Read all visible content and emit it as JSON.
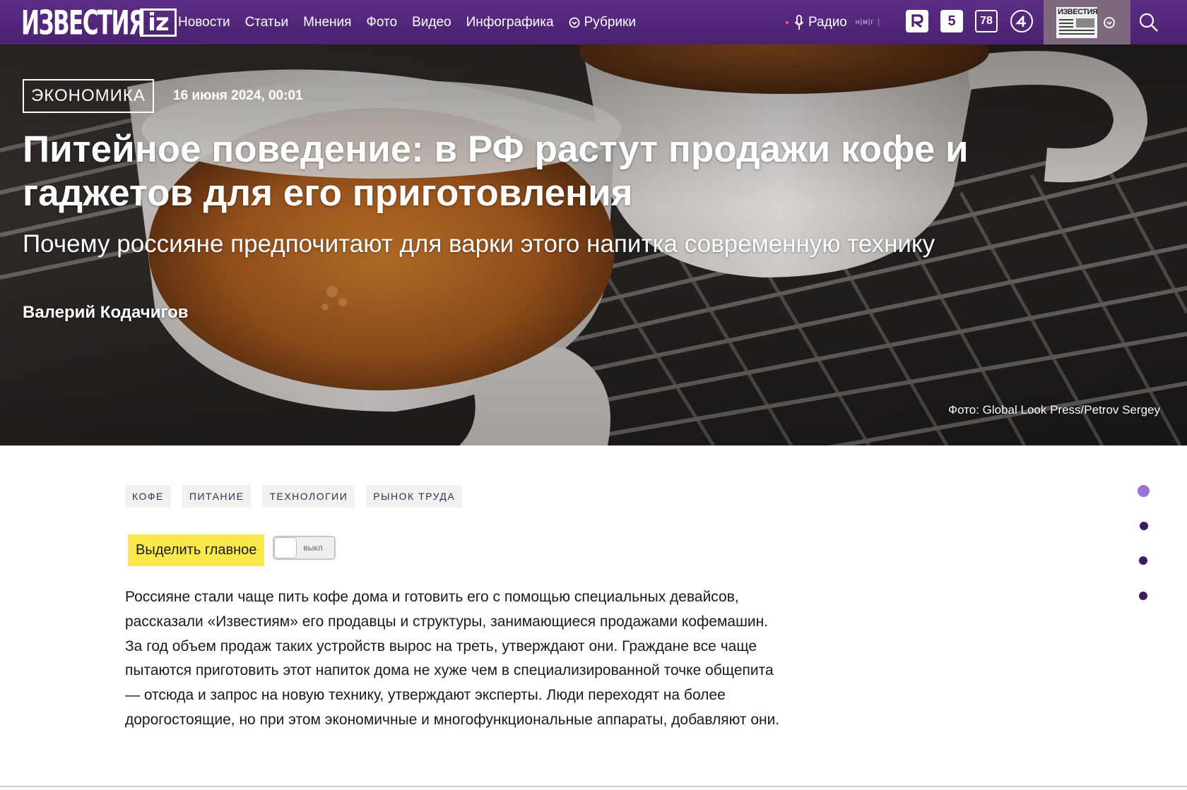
{
  "header": {
    "logo_text": "ИЗВЕСТИЯ",
    "logo_badge": "iz",
    "nav": [
      "Новости",
      "Статьи",
      "Мнения",
      "Фото",
      "Видео",
      "Инфографика"
    ],
    "rubrics_label": "Рубрики",
    "radio_label": "Радио",
    "radio_freq": "н|м|г",
    "channels": [
      {
        "icon": "channel-5-icon",
        "label": "5"
      },
      {
        "icon": "channel-78-icon",
        "label": "78"
      }
    ],
    "paper_icon_text": "ИЗВЕСТИЯ",
    "accent_color": "#4a2270"
  },
  "article": {
    "rubric": "ЭКОНОМИКА",
    "date": "16 июня 2024, 00:01",
    "headline": "Питейное поведение: в РФ растут продажи кофе и гаджетов для его приготовления",
    "subtitle": "Почему россияне предпочитают для варки этого напитка современную технику",
    "author": "Валерий Кодачигов",
    "photo_credit": "Фото: Global Look Press/Petrov Sergey",
    "tags": [
      "КОФЕ",
      "ПИТАНИЕ",
      "ТЕХНОЛОГИИ",
      "РЫНОК ТРУДА"
    ],
    "highlight_label": "Выделить главное",
    "toggle_label": "выкл",
    "lead": "Россияне стали чаще пить кофе дома и готовить его с помощью специальных девайсов, рассказали «Известиям» его продавцы и структуры, занимающиеся продажами кофемашин. За год объем продаж таких устройств вырос на треть, утверждают они. Граждане все чаще пытаются приготовить этот напиток дома не хуже чем в специализированной точке общепита — отсюда и запрос на новую технику, утверждают эксперты. Люди переходят на более дорогостоящие, но при этом экономичные и многофункциональные аппараты, добавляют они.",
    "highlight_color": "#fbe94b",
    "active_dot_color": "#9b72d6"
  }
}
